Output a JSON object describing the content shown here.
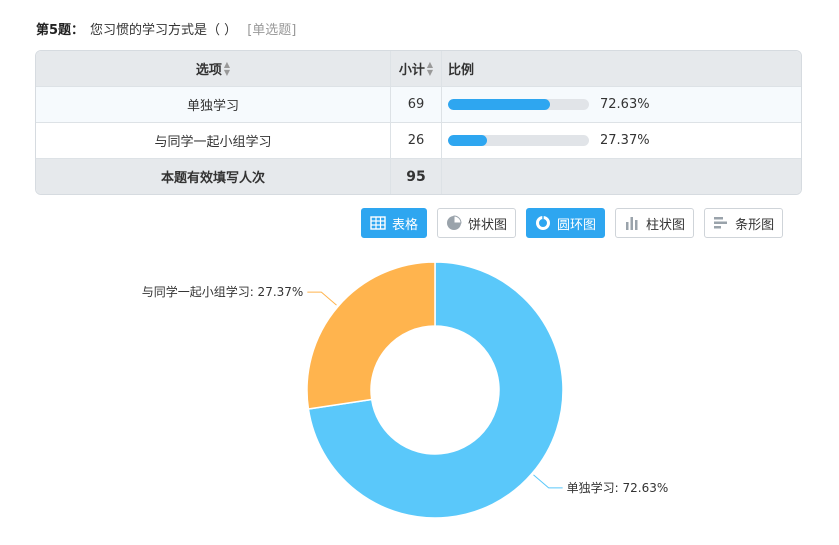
{
  "question": {
    "number": "第5题：",
    "text": "您习惯的学习方式是（ ）",
    "type": "[单选题]"
  },
  "table": {
    "headers": {
      "option": "选项",
      "count": "小计",
      "ratio": "比例"
    },
    "rows": [
      {
        "option": "单独学习",
        "count": "69",
        "percent": "72.63%",
        "fraction": 0.7263
      },
      {
        "option": "与同学一起小组学习",
        "count": "26",
        "percent": "27.37%",
        "fraction": 0.2737
      }
    ],
    "total": {
      "label": "本题有效填写人次",
      "count": "95"
    }
  },
  "views": {
    "table": "表格",
    "pie": "饼状图",
    "donut": "圆环图",
    "column": "柱状图",
    "bar": "条形图",
    "active": [
      "table",
      "donut"
    ]
  },
  "colors": {
    "accent": "#2ea6f0",
    "slice1": "#5ac8fa",
    "slice2": "#ffb44e"
  },
  "chart_data": {
    "type": "pie",
    "variant": "donut",
    "categories": [
      "单独学习",
      "与同学一起小组学习"
    ],
    "values": [
      72.63,
      27.37
    ],
    "labels": [
      "单独学习: 72.63%",
      "与同学一起小组学习: 27.37%"
    ],
    "colors": [
      "#5ac8fa",
      "#ffb44e"
    ]
  }
}
